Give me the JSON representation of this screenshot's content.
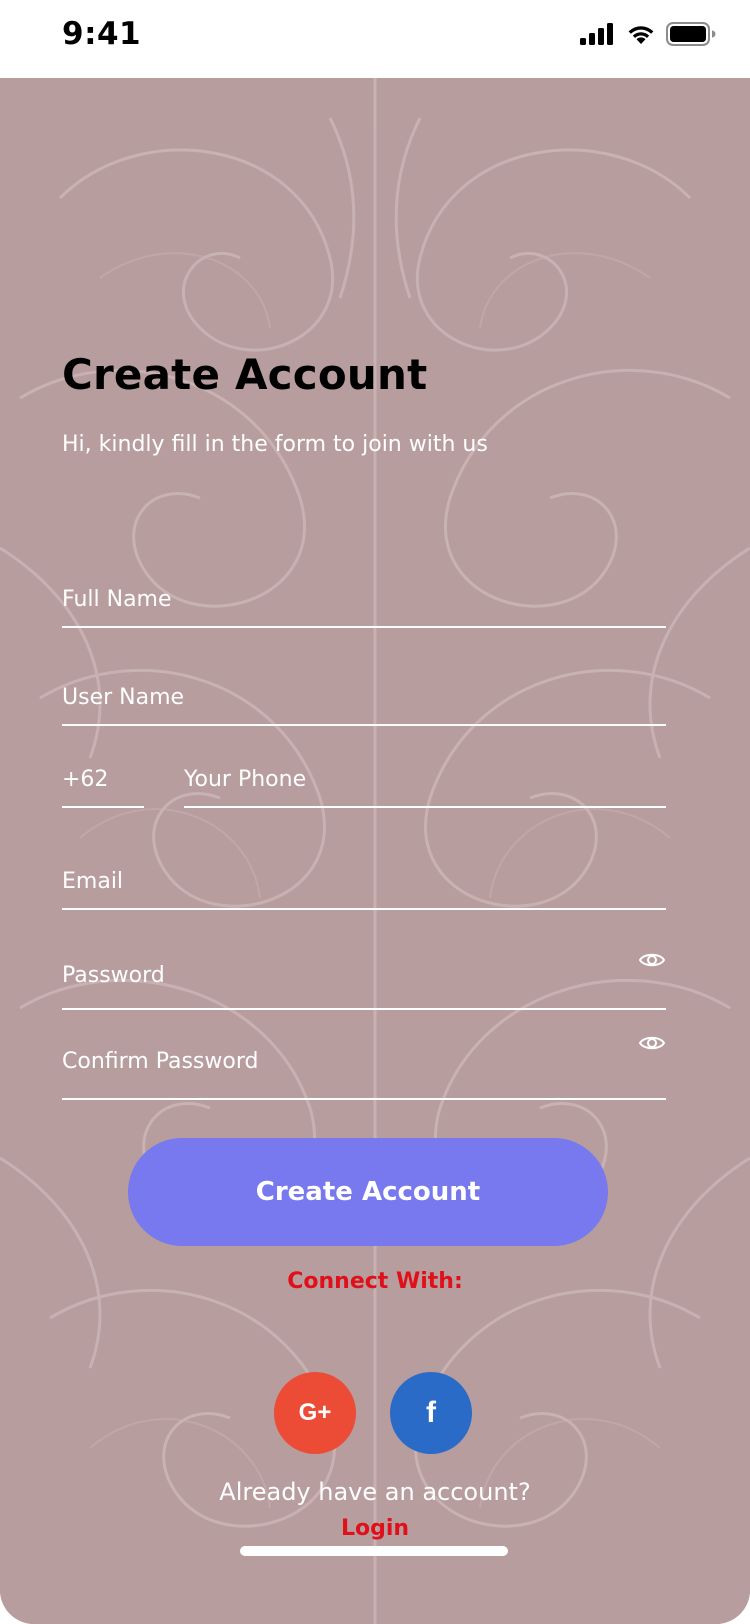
{
  "status_bar": {
    "time": "9:41",
    "icons": [
      "cellular-signal-icon",
      "wifi-icon",
      "battery-icon"
    ]
  },
  "form": {
    "title": "Create Account",
    "subtitle": "Hi, kindly fill in the form to join with us",
    "full_name_placeholder": "Full Name",
    "username_placeholder": "User Name",
    "country_code_value": "+62",
    "phone_placeholder": "Your Phone",
    "email_placeholder": "Email",
    "password_placeholder": "Password",
    "confirm_password_placeholder": "Confirm Password",
    "submit_label": "Create Account"
  },
  "social": {
    "heading": "Connect With:",
    "google_label": "G+",
    "facebook_label": "f"
  },
  "footer": {
    "prompt": "Already have an account?",
    "login_label": "Login"
  },
  "colors": {
    "background": "#b89d9e",
    "primary_button": "#7878ef",
    "accent_red": "#e0101a",
    "google": "#ec4b36",
    "facebook": "#2a6bc7"
  }
}
